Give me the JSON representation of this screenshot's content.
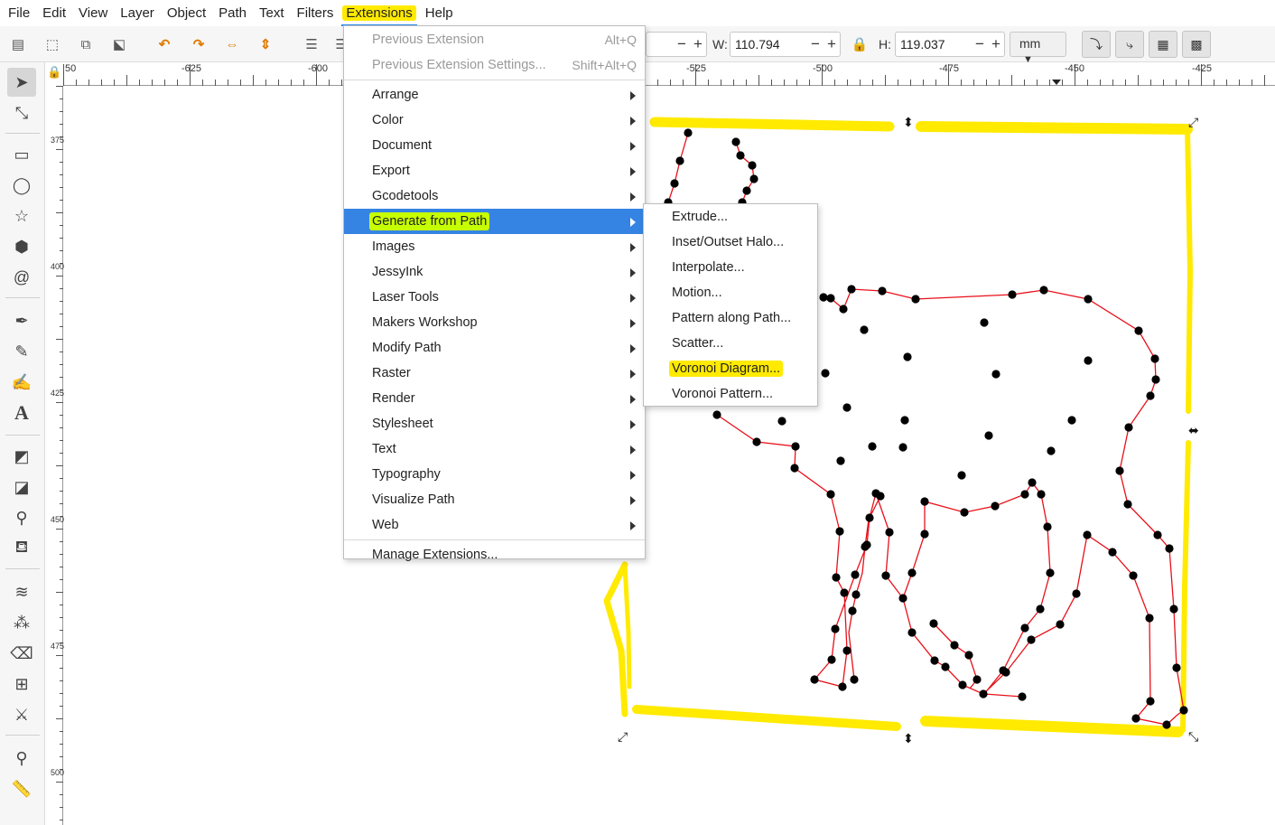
{
  "menubar": {
    "items": [
      "File",
      "Edit",
      "View",
      "Layer",
      "Object",
      "Path",
      "Text",
      "Filters",
      "Extensions",
      "Help"
    ],
    "active": "Extensions"
  },
  "toolbar": {
    "w_label": "W:",
    "w_value": "110.794",
    "h_label": "H:",
    "h_value": "119.037",
    "unit": "mm"
  },
  "ruler": {
    "labels": [
      "50",
      "-625",
      "-600",
      "-525",
      "-500",
      "-475",
      "-450",
      "-425"
    ]
  },
  "vruler": {
    "labels": [
      "375",
      "400",
      "425",
      "450",
      "475",
      "500"
    ]
  },
  "extensions_menu": {
    "top_items": [
      {
        "label": "Previous Extension",
        "accel": "Alt+Q",
        "disabled": true
      },
      {
        "label": "Previous Extension Settings...",
        "accel": "Shift+Alt+Q",
        "disabled": true
      }
    ],
    "items": [
      {
        "label": "Arrange",
        "submenu": true
      },
      {
        "label": "Color",
        "submenu": true
      },
      {
        "label": "Document",
        "submenu": true
      },
      {
        "label": "Export",
        "submenu": true
      },
      {
        "label": "Gcodetools",
        "submenu": true
      },
      {
        "label": "Generate from Path",
        "submenu": true,
        "hover": true
      },
      {
        "label": "Images",
        "submenu": true
      },
      {
        "label": "JessyInk",
        "submenu": true
      },
      {
        "label": "Laser Tools",
        "submenu": true
      },
      {
        "label": "Makers Workshop",
        "submenu": true
      },
      {
        "label": "Modify Path",
        "submenu": true
      },
      {
        "label": "Raster",
        "submenu": true
      },
      {
        "label": "Render",
        "submenu": true
      },
      {
        "label": "Stylesheet",
        "submenu": true
      },
      {
        "label": "Text",
        "submenu": true
      },
      {
        "label": "Typography",
        "submenu": true
      },
      {
        "label": "Visualize Path",
        "submenu": true
      },
      {
        "label": "Web",
        "submenu": true
      }
    ],
    "manage": "Manage Extensions..."
  },
  "generate_submenu": {
    "items": [
      "Extrude...",
      "Inset/Outset Halo...",
      "Interpolate...",
      "Motion...",
      "Pattern along Path...",
      "Scatter...",
      "Voronoi Diagram...",
      "Voronoi Pattern..."
    ],
    "highlighted": "Voronoi Diagram..."
  },
  "colors": {
    "highlight_yellow": "#ffea00",
    "menu_hover_blue": "#3584e4",
    "path_red": "#e8101a",
    "node_black": "#000000"
  }
}
